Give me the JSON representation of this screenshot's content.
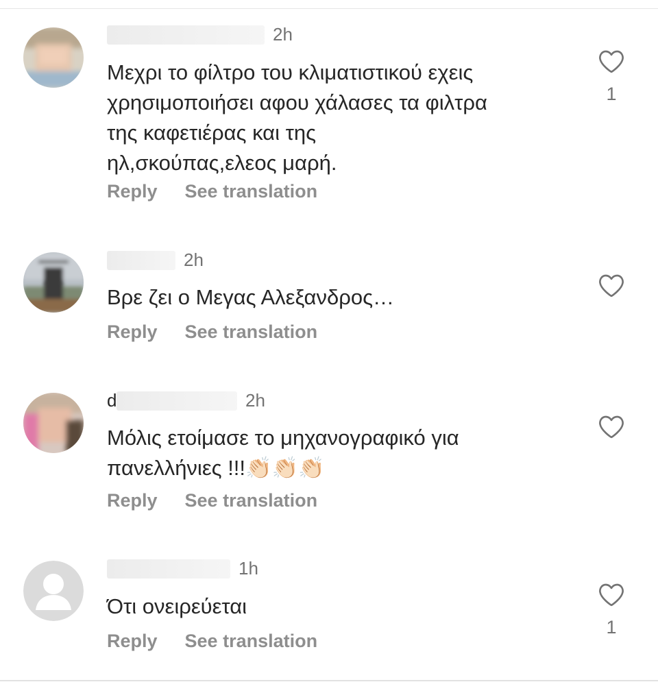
{
  "comments": [
    {
      "time": "2h",
      "text": "Μεχρι το φίλτρο του κλιματιστικού εχεις\nχρησιμοποιήσει αφου χάλασες τα φιλτρα\nτης καφετιέρας και της\nηλ,σκούπας,ελεος μαρή.",
      "reply_label": "Reply",
      "translate_label": "See translation",
      "likes": "1"
    },
    {
      "time": "2h",
      "text": "Βρε ζει ο Μεγας Αλεξανδρος…",
      "reply_label": "Reply",
      "translate_label": "See translation",
      "likes": ""
    },
    {
      "username_visible": "d",
      "time": "2h",
      "text": "Μόλις ετοίμασε το μηχανογραφικό για\nπανελλήνιες !!!👏🏻👏🏻👏🏻",
      "reply_label": "Reply",
      "translate_label": "See translation",
      "likes": ""
    },
    {
      "time": "1h",
      "text": "Ότι ονειρεύεται",
      "reply_label": "Reply",
      "translate_label": "See translation",
      "likes": "1"
    }
  ],
  "icons": {
    "like": "heart-outline-icon",
    "default_avatar": "default-avatar-icon"
  },
  "colors": {
    "text": "#262626",
    "secondary": "#8e8e8e",
    "time": "#737373"
  }
}
